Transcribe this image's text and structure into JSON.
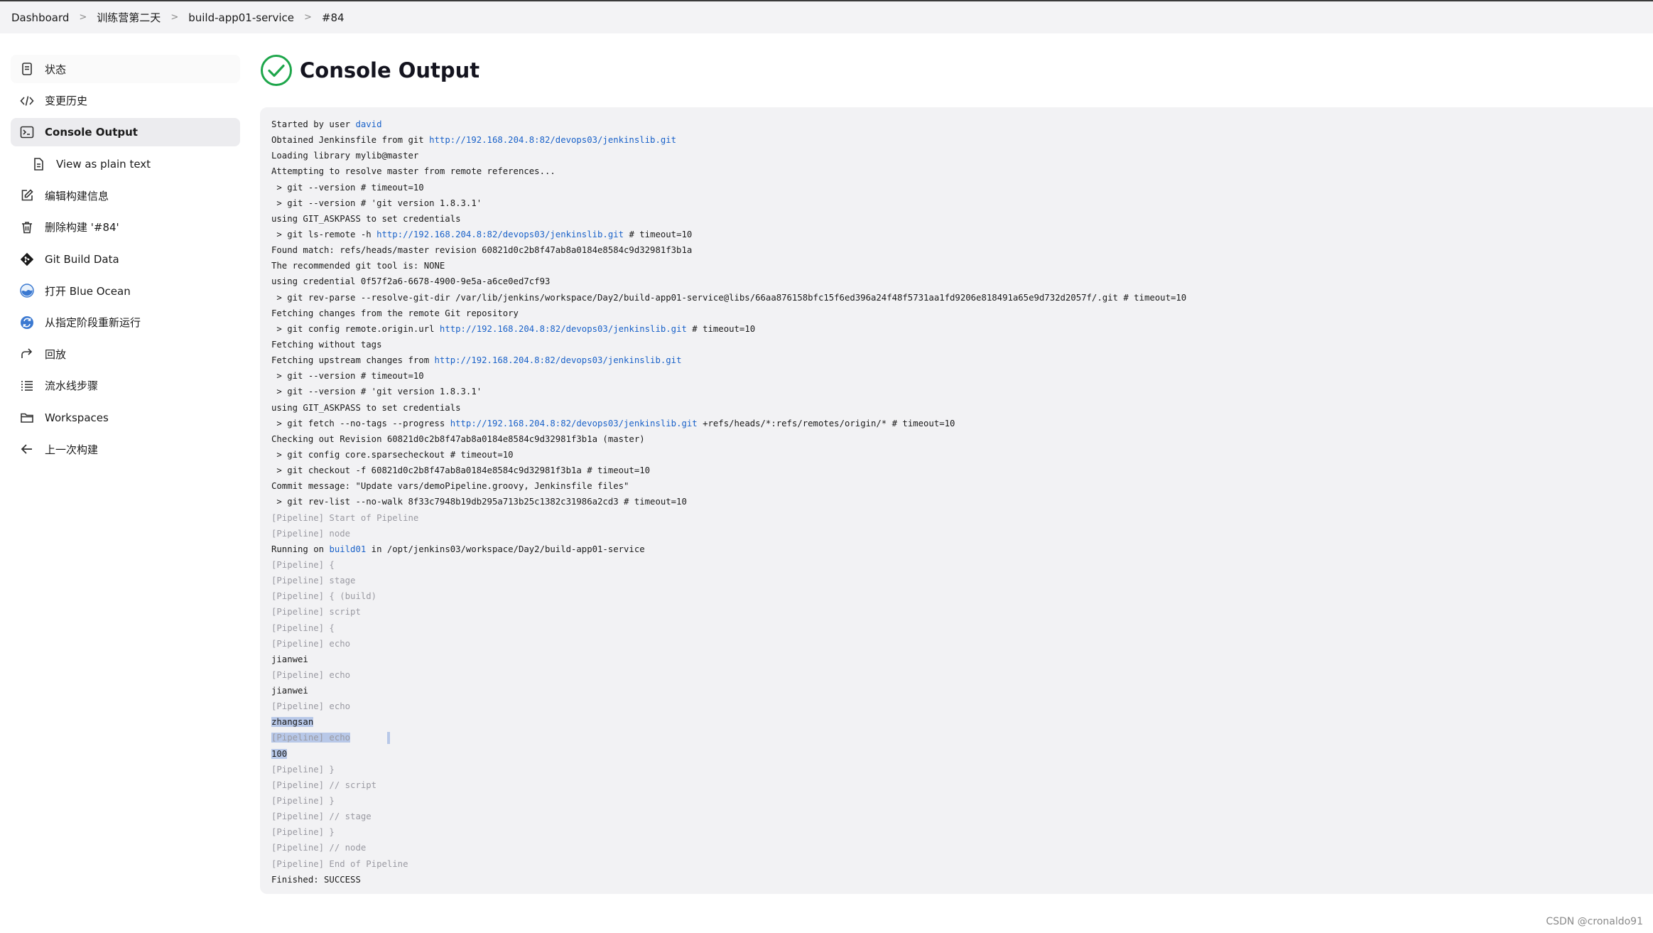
{
  "breadcrumb": [
    "Dashboard",
    "训练营第二天",
    "build-app01-service",
    "#84"
  ],
  "sidebar": [
    {
      "label": "状态",
      "icon": "document-icon"
    },
    {
      "label": "变更历史",
      "icon": "code-icon"
    },
    {
      "label": "Console Output",
      "icon": "terminal-icon",
      "active": true
    },
    {
      "label": "View as plain text",
      "icon": "file-icon",
      "sub": true
    },
    {
      "label": "编辑构建信息",
      "icon": "edit-icon"
    },
    {
      "label": "删除构建 '#84'",
      "icon": "trash-icon"
    },
    {
      "label": "Git Build Data",
      "icon": "git-icon"
    },
    {
      "label": "打开 Blue Ocean",
      "icon": "blue-ocean-icon"
    },
    {
      "label": "从指定阶段重新运行",
      "icon": "restart-stage-icon"
    },
    {
      "label": "回放",
      "icon": "replay-icon"
    },
    {
      "label": "流水线步骤",
      "icon": "list-icon"
    },
    {
      "label": "Workspaces",
      "icon": "folder-icon"
    },
    {
      "label": "上一次构建",
      "icon": "arrow-left-icon"
    }
  ],
  "page_title": "Console Output",
  "status_icon": "success-check-icon",
  "colors": {
    "success": "#1ea64b",
    "link": "#1a62c9",
    "pipeline_text": "#9a9aa2"
  },
  "console_lines": [
    {
      "segments": [
        {
          "t": "Started by user "
        },
        {
          "t": "david",
          "link": true
        }
      ]
    },
    {
      "segments": [
        {
          "t": "Obtained Jenkinsfile from git "
        },
        {
          "t": "http://192.168.204.8:82/devops03/jenkinslib.git",
          "link": true
        }
      ]
    },
    {
      "segments": [
        {
          "t": "Loading library mylib@master"
        }
      ]
    },
    {
      "segments": [
        {
          "t": "Attempting to resolve master from remote references..."
        }
      ]
    },
    {
      "segments": [
        {
          "t": " > git --version # timeout=10"
        }
      ]
    },
    {
      "segments": [
        {
          "t": " > git --version # 'git version 1.8.3.1'"
        }
      ]
    },
    {
      "segments": [
        {
          "t": "using GIT_ASKPASS to set credentials"
        }
      ]
    },
    {
      "segments": [
        {
          "t": " > git ls-remote -h "
        },
        {
          "t": "http://192.168.204.8:82/devops03/jenkinslib.git",
          "link": true
        },
        {
          "t": " # timeout=10"
        }
      ]
    },
    {
      "segments": [
        {
          "t": "Found match: refs/heads/master revision 60821d0c2b8f47ab8a0184e8584c9d32981f3b1a"
        }
      ]
    },
    {
      "segments": [
        {
          "t": "The recommended git tool is: NONE"
        }
      ]
    },
    {
      "segments": [
        {
          "t": "using credential 0f57f2a6-6678-4900-9e5a-a6ce0ed7cf93"
        }
      ]
    },
    {
      "segments": [
        {
          "t": " > git rev-parse --resolve-git-dir /var/lib/jenkins/workspace/Day2/build-app01-service@libs/66aa876158bfc15f6ed396a24f48f5731aa1fd9206e818491a65e9d732d2057f/.git # timeout=10"
        }
      ]
    },
    {
      "segments": [
        {
          "t": "Fetching changes from the remote Git repository"
        }
      ]
    },
    {
      "segments": [
        {
          "t": " > git config remote.origin.url "
        },
        {
          "t": "http://192.168.204.8:82/devops03/jenkinslib.git",
          "link": true
        },
        {
          "t": " # timeout=10"
        }
      ]
    },
    {
      "segments": [
        {
          "t": "Fetching without tags"
        }
      ]
    },
    {
      "segments": [
        {
          "t": "Fetching upstream changes from "
        },
        {
          "t": "http://192.168.204.8:82/devops03/jenkinslib.git",
          "link": true
        }
      ]
    },
    {
      "segments": [
        {
          "t": " > git --version # timeout=10"
        }
      ]
    },
    {
      "segments": [
        {
          "t": " > git --version # 'git version 1.8.3.1'"
        }
      ]
    },
    {
      "segments": [
        {
          "t": "using GIT_ASKPASS to set credentials"
        }
      ]
    },
    {
      "segments": [
        {
          "t": " > git fetch --no-tags --progress "
        },
        {
          "t": "http://192.168.204.8:82/devops03/jenkinslib.git",
          "link": true
        },
        {
          "t": " +refs/heads/*:refs/remotes/origin/* # timeout=10"
        }
      ]
    },
    {
      "segments": [
        {
          "t": "Checking out Revision 60821d0c2b8f47ab8a0184e8584c9d32981f3b1a (master)"
        }
      ]
    },
    {
      "segments": [
        {
          "t": " > git config core.sparsecheckout # timeout=10"
        }
      ]
    },
    {
      "segments": [
        {
          "t": " > git checkout -f 60821d0c2b8f47ab8a0184e8584c9d32981f3b1a # timeout=10"
        }
      ]
    },
    {
      "segments": [
        {
          "t": "Commit message: \"Update vars/demoPipeline.groovy, Jenkinsfile files\""
        }
      ]
    },
    {
      "segments": [
        {
          "t": " > git rev-list --no-walk 8f33c7948b19db295a713b25c1382c31986a2cd3 # timeout=10"
        }
      ]
    },
    {
      "pipe": true,
      "segments": [
        {
          "t": "[Pipeline] Start of Pipeline"
        }
      ]
    },
    {
      "pipe": true,
      "segments": [
        {
          "t": "[Pipeline] node"
        }
      ]
    },
    {
      "segments": [
        {
          "t": "Running on "
        },
        {
          "t": "build01",
          "link": true
        },
        {
          "t": " in /opt/jenkins03/workspace/Day2/build-app01-service"
        }
      ]
    },
    {
      "pipe": true,
      "segments": [
        {
          "t": "[Pipeline] {"
        }
      ]
    },
    {
      "pipe": true,
      "segments": [
        {
          "t": "[Pipeline] stage"
        }
      ]
    },
    {
      "pipe": true,
      "segments": [
        {
          "t": "[Pipeline] { (build)"
        }
      ]
    },
    {
      "pipe": true,
      "segments": [
        {
          "t": "[Pipeline] script"
        }
      ]
    },
    {
      "pipe": true,
      "segments": [
        {
          "t": "[Pipeline] {"
        }
      ]
    },
    {
      "pipe": true,
      "segments": [
        {
          "t": "[Pipeline] echo"
        }
      ]
    },
    {
      "segments": [
        {
          "t": "jianwei"
        }
      ]
    },
    {
      "pipe": true,
      "segments": [
        {
          "t": "[Pipeline] echo"
        }
      ]
    },
    {
      "segments": [
        {
          "t": "jianwei"
        }
      ]
    },
    {
      "pipe": true,
      "segments": [
        {
          "t": "[Pipeline] echo"
        }
      ]
    },
    {
      "segments": [
        {
          "t": "zhangsan",
          "sel": true
        }
      ]
    },
    {
      "pipe": true,
      "segments": [
        {
          "t": "[Pipeline] echo",
          "sel": true
        }
      ],
      "caret": true
    },
    {
      "segments": [
        {
          "t": "100",
          "sel": true
        }
      ]
    },
    {
      "pipe": true,
      "segments": [
        {
          "t": "[Pipeline] }"
        }
      ]
    },
    {
      "pipe": true,
      "segments": [
        {
          "t": "[Pipeline] // script"
        }
      ]
    },
    {
      "pipe": true,
      "segments": [
        {
          "t": "[Pipeline] }"
        }
      ]
    },
    {
      "pipe": true,
      "segments": [
        {
          "t": "[Pipeline] // stage"
        }
      ]
    },
    {
      "pipe": true,
      "segments": [
        {
          "t": "[Pipeline] }"
        }
      ]
    },
    {
      "pipe": true,
      "segments": [
        {
          "t": "[Pipeline] // node"
        }
      ]
    },
    {
      "pipe": true,
      "segments": [
        {
          "t": "[Pipeline] End of Pipeline"
        }
      ]
    },
    {
      "segments": [
        {
          "t": "Finished: SUCCESS"
        }
      ]
    }
  ],
  "watermark": "CSDN @cronaldo91"
}
